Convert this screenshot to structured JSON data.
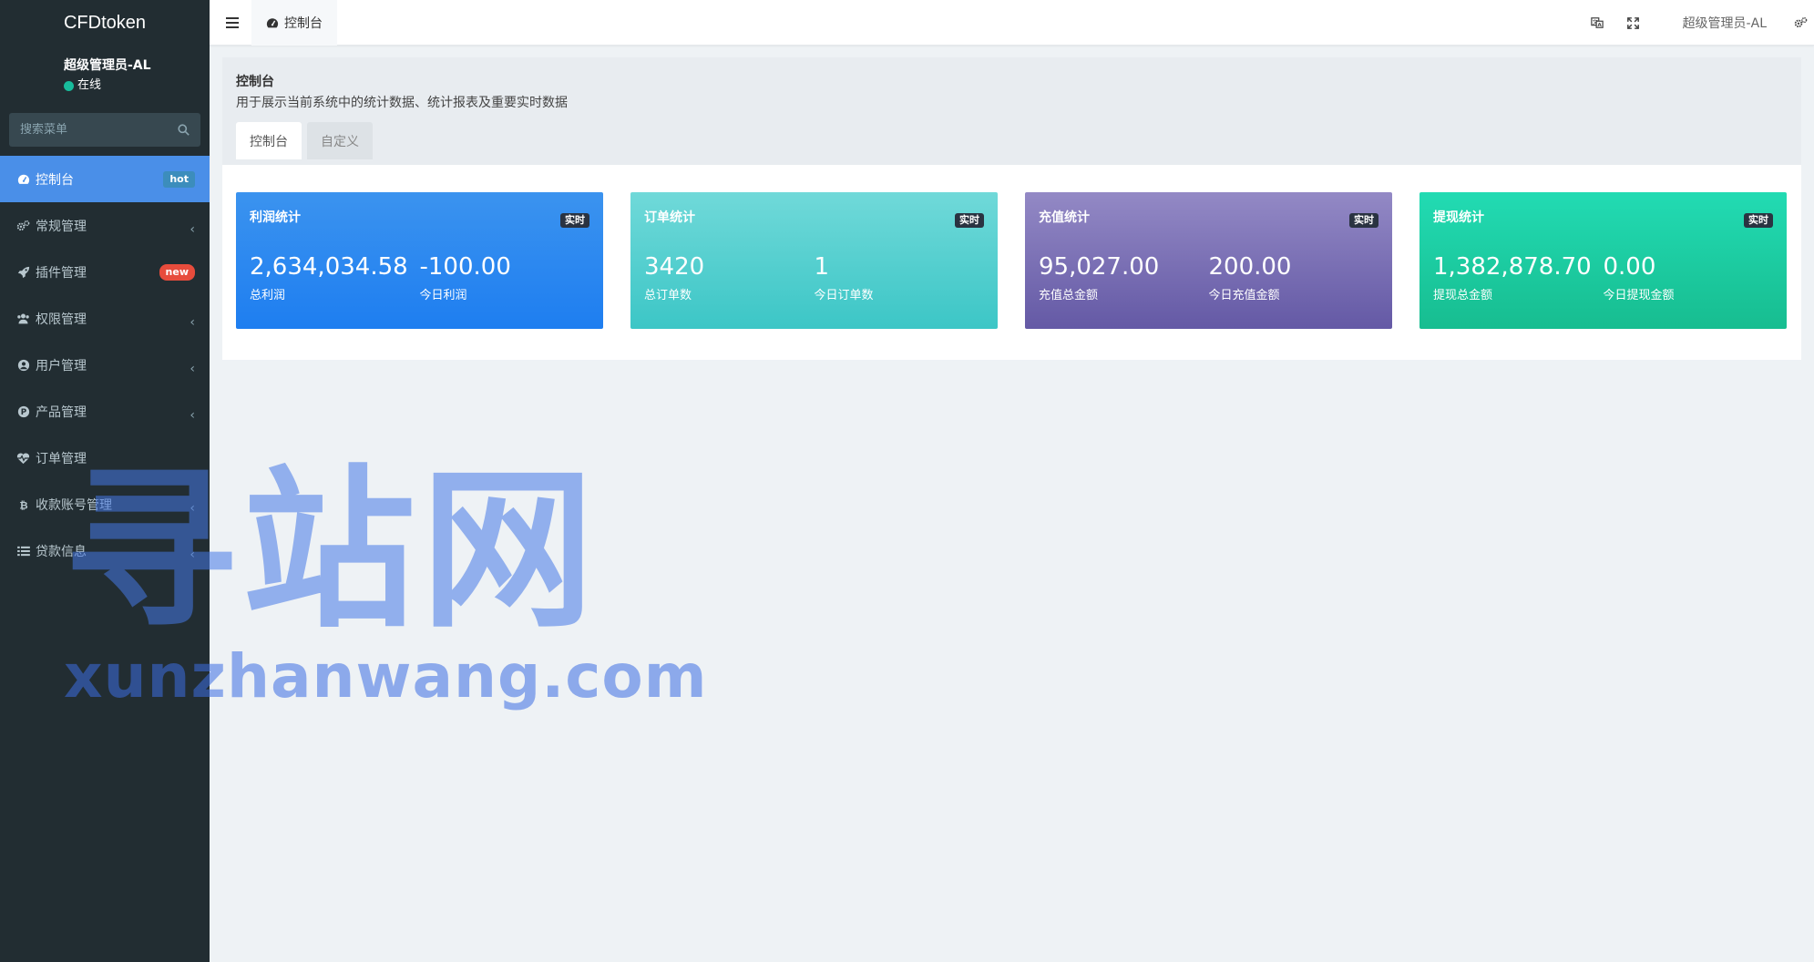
{
  "sidebar": {
    "brand": "CFDtoken",
    "user_name": "超级管理员-AL",
    "user_status": "在线",
    "search_placeholder": "搜索菜单",
    "items": [
      {
        "label": "控制台",
        "icon": "dashboard-icon",
        "badge": "hot",
        "active": true
      },
      {
        "label": "常规管理",
        "icon": "cogs-icon",
        "expandable": true
      },
      {
        "label": "插件管理",
        "icon": "rocket-icon",
        "badge": "new"
      },
      {
        "label": "权限管理",
        "icon": "users-icon",
        "expandable": true
      },
      {
        "label": "用户管理",
        "icon": "user-circle-icon",
        "expandable": true
      },
      {
        "label": "产品管理",
        "icon": "product-p-icon",
        "expandable": true
      },
      {
        "label": "订单管理",
        "icon": "heartbeat-icon"
      },
      {
        "label": "收款账号管理",
        "icon": "bitcoin-icon",
        "expandable": true
      },
      {
        "label": "贷款信息",
        "icon": "list-icon",
        "expandable": true
      }
    ]
  },
  "header": {
    "tab_label": "控制台",
    "user_label": "超级管理员-AL"
  },
  "panel": {
    "title": "控制台",
    "description": "用于展示当前系统中的统计数据、统计报表及重要实时数据",
    "tabs": [
      {
        "label": "控制台",
        "active": true
      },
      {
        "label": "自定义",
        "active": false
      }
    ]
  },
  "cards": [
    {
      "title": "利润统计",
      "badge": "实时",
      "color": "#2a88ef",
      "stats": [
        {
          "value": "2,634,034.58",
          "label": "总利润"
        },
        {
          "value": "-100.00",
          "label": "今日利润"
        }
      ]
    },
    {
      "title": "订单统计",
      "badge": "实时",
      "color": "#55cfcf",
      "stats": [
        {
          "value": "3420",
          "label": "总订单数"
        },
        {
          "value": "1",
          "label": "今日订单数"
        }
      ]
    },
    {
      "title": "充值统计",
      "badge": "实时",
      "color": "#7a70b5",
      "stats": [
        {
          "value": "95,027.00",
          "label": "充值总金额"
        },
        {
          "value": "200.00",
          "label": "今日充值金额"
        }
      ]
    },
    {
      "title": "提现统计",
      "badge": "实时",
      "color": "#1ccca1",
      "stats": [
        {
          "value": "1,382,878.70",
          "label": "提现总金额"
        },
        {
          "value": "0.00",
          "label": "今日提现金额"
        }
      ]
    }
  ],
  "watermark": {
    "cn": "寻站网",
    "en": "xunzhanwang.com"
  }
}
